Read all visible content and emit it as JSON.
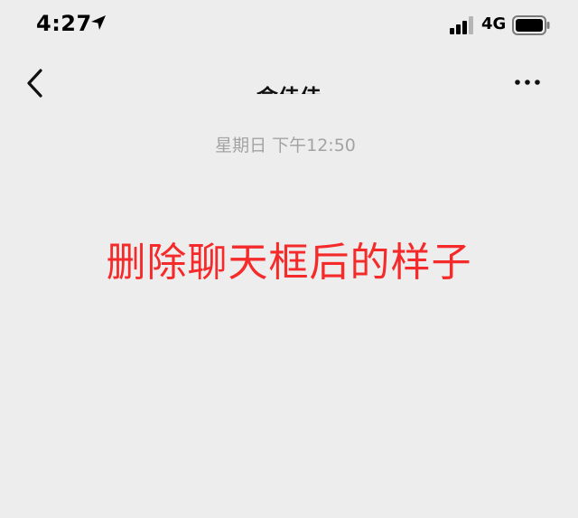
{
  "status_bar": {
    "time": "4:27",
    "network": "4G",
    "icons": [
      "location-arrow-icon",
      "signal-bars-icon",
      "battery-icon"
    ]
  },
  "nav": {
    "back_icon": "chevron-left-icon",
    "title": "俞佳佳",
    "more_icon": "ellipsis-icon"
  },
  "chat": {
    "timestamp": "星期日 下午12:50"
  },
  "annotation": {
    "text": "删除聊天框后的样子",
    "color": "#f52a2a"
  },
  "colors": {
    "background": "#ededed",
    "timestamp": "#a3a3a3"
  }
}
